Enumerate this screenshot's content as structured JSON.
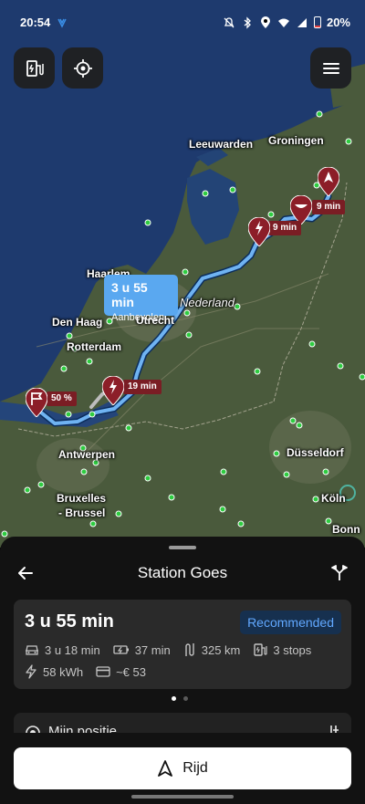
{
  "status_bar": {
    "time": "20:54",
    "battery": "20%"
  },
  "map": {
    "route_bubble": {
      "time": "3 u 55 min",
      "label": "Aanbevolen"
    },
    "pins": [
      {
        "label": "9 min"
      },
      {
        "label": "9 min"
      },
      {
        "label": "19 min"
      },
      {
        "label": "50 %"
      }
    ],
    "cities": [
      {
        "name": "Leeuwarden"
      },
      {
        "name": "Groningen"
      },
      {
        "name": "Haarlem"
      },
      {
        "name": "Nederland"
      },
      {
        "name": "Utrecht"
      },
      {
        "name": "Den Haag"
      },
      {
        "name": "Rotterdam"
      },
      {
        "name": "Antwerpen"
      },
      {
        "name": "Bruxelles"
      },
      {
        "name": "- Brussel"
      },
      {
        "name": "Düsseldorf"
      },
      {
        "name": "Köln"
      },
      {
        "name": "Bonn"
      }
    ]
  },
  "sheet": {
    "title": "Station Goes",
    "route_card": {
      "time": "3 u 55 min",
      "badge": "Recommended",
      "drive_time": "3 u 18 min",
      "charge_time": "37 min",
      "distance": "325 km",
      "stops": "3 stops",
      "energy": "58 kWh",
      "cost": "~€ 53"
    },
    "waypoint": "Mijn positie",
    "drive_button": "Rijd"
  }
}
